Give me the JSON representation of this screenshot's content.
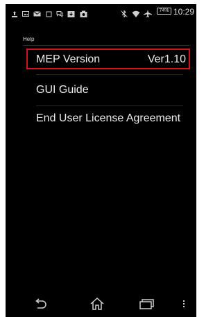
{
  "status_bar": {
    "icons": [
      "usb-debug-icon",
      "photo-icon",
      "mail-icon",
      "square-icon",
      "chat-icon",
      "download-icon",
      "camera-icon",
      "bluetooth-icon",
      "wifi-icon",
      "airplane-icon",
      "battery-icon"
    ],
    "battery_percent": "74%",
    "time": "10:29"
  },
  "screen": {
    "header": "Help",
    "items": [
      {
        "label": "MEP Version",
        "value": "Ver1.10",
        "highlighted": true
      },
      {
        "label": "GUI Guide"
      },
      {
        "label": "End User License Agreement"
      }
    ]
  },
  "nav_bar": {
    "buttons": [
      "back-icon",
      "home-icon",
      "recent-apps-icon",
      "overflow-menu-icon"
    ]
  },
  "colors": {
    "background": "#000000",
    "highlight_border": "#d4141c",
    "text": "#ececec"
  }
}
